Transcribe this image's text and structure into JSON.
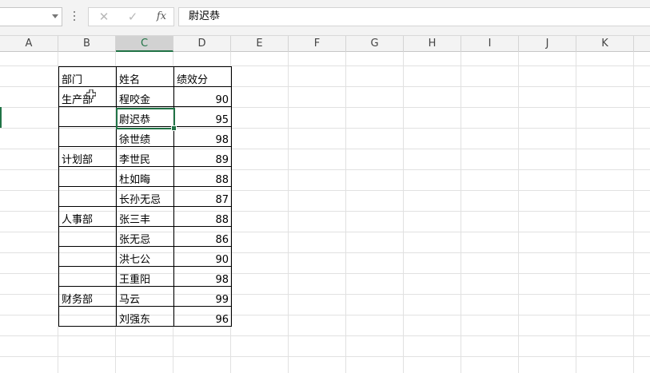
{
  "name_box": {
    "value": ""
  },
  "formula_bar": {
    "cancel_glyph": "✕",
    "enter_glyph": "✓",
    "fx_label": "fx",
    "value": "尉迟恭"
  },
  "columns": [
    "A",
    "B",
    "C",
    "D",
    "E",
    "F",
    "G",
    "H",
    "I",
    "J",
    "K"
  ],
  "active_column": "C",
  "table": {
    "headers": {
      "dept": "部门",
      "name": "姓名",
      "score": "绩效分"
    },
    "rows": [
      {
        "dept": "生产部",
        "name": "程咬金",
        "score": "90"
      },
      {
        "dept": "",
        "name": "尉迟恭",
        "score": "95"
      },
      {
        "dept": "",
        "name": "徐世绩",
        "score": "98"
      },
      {
        "dept": "计划部",
        "name": "李世民",
        "score": "89"
      },
      {
        "dept": "",
        "name": "杜如晦",
        "score": "88"
      },
      {
        "dept": "",
        "name": "长孙无忌",
        "score": "87"
      },
      {
        "dept": "人事部",
        "name": "张三丰",
        "score": "88"
      },
      {
        "dept": "",
        "name": "张无忌",
        "score": "86"
      },
      {
        "dept": "",
        "name": "洪七公",
        "score": "90"
      },
      {
        "dept": "",
        "name": "王重阳",
        "score": "98"
      },
      {
        "dept": "财务部",
        "name": "马云",
        "score": "99"
      },
      {
        "dept": "",
        "name": "刘强东",
        "score": "96"
      }
    ]
  },
  "colors": {
    "accent": "#217346",
    "grid": "#e1e1e1",
    "header_bg": "#f3f3f3"
  }
}
